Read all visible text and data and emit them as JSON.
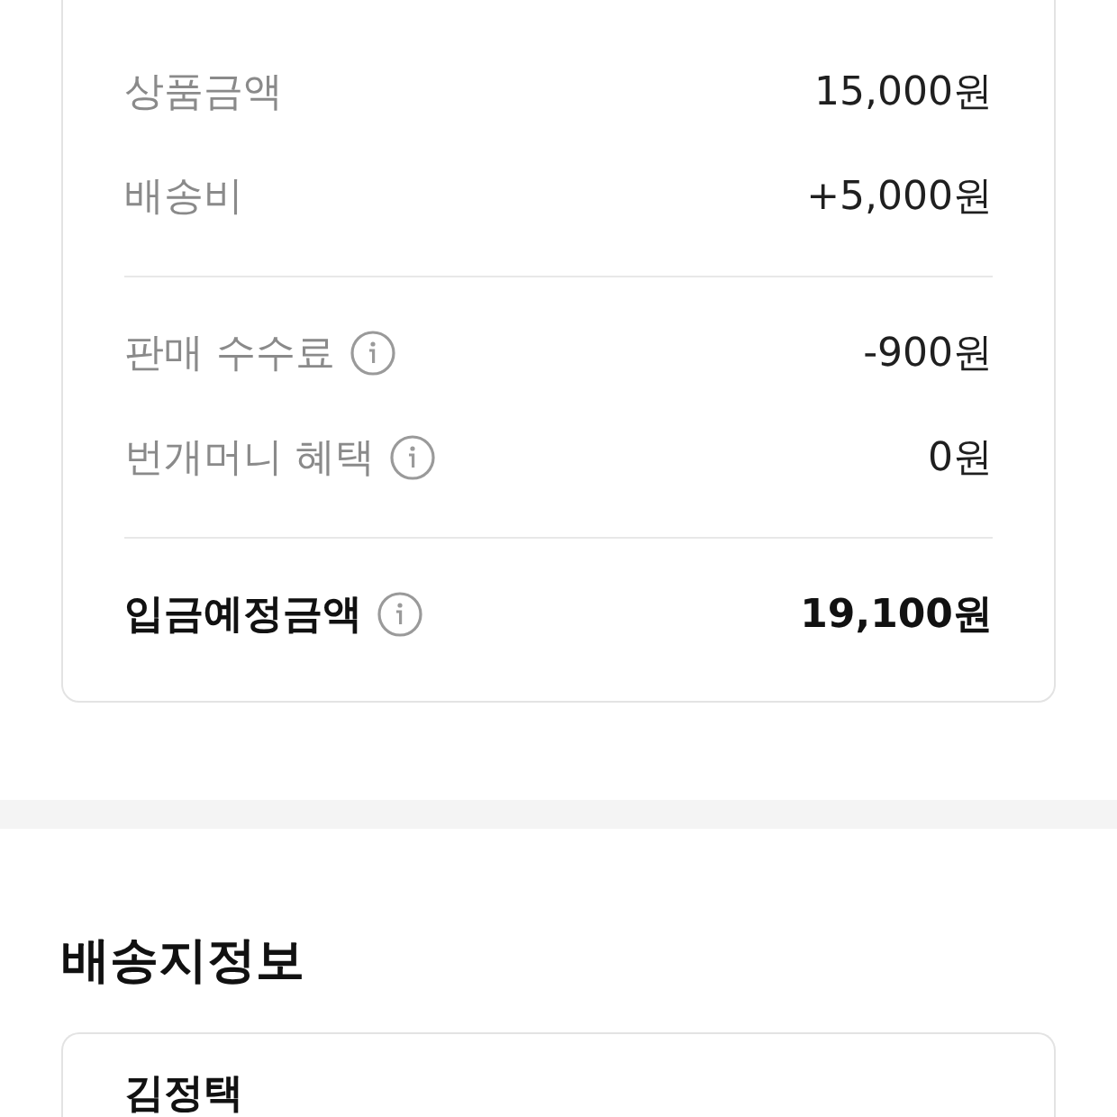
{
  "summary": {
    "groups": [
      {
        "rows": [
          {
            "label": "상품금액",
            "value": "15,000원",
            "info": false
          },
          {
            "label": "배송비",
            "value": "+5,000원",
            "info": false
          }
        ]
      },
      {
        "rows": [
          {
            "label": "판매 수수료",
            "value": "-900원",
            "info": true
          },
          {
            "label": "번개머니 혜택",
            "value": "0원",
            "info": true
          }
        ]
      }
    ],
    "total": {
      "label": "입금예정금액",
      "value": "19,100원",
      "info": true
    }
  },
  "shipping": {
    "heading": "배송지정보",
    "recipient_name": "김정택"
  }
}
